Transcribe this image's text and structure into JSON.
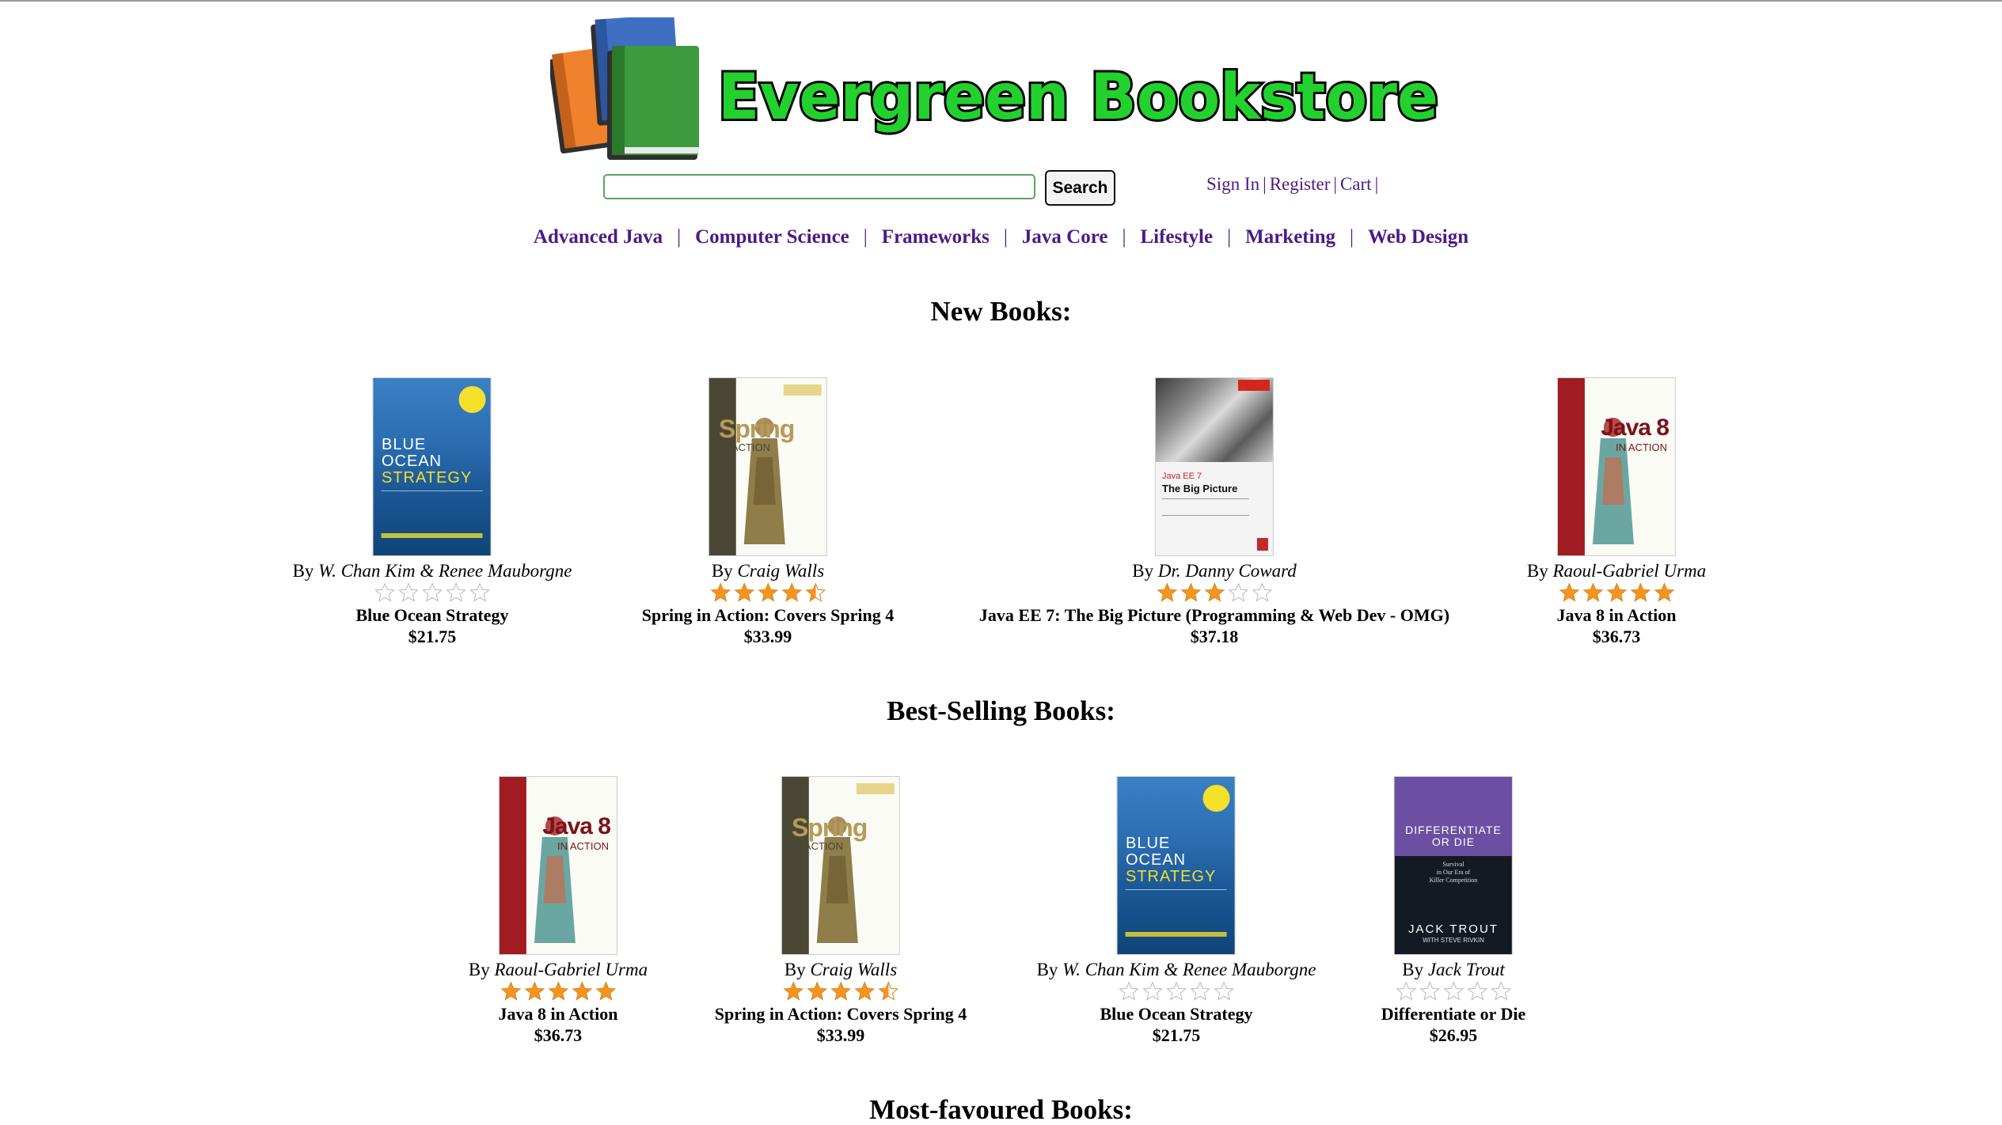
{
  "header": {
    "logo_text": "Evergreen Bookstore",
    "logo_colors": {
      "text_fill": "#22d12e",
      "text_outline": "#000000",
      "book_orange": "#f0822d",
      "book_blue": "#3f6fc2",
      "book_green": "#3c9b3c"
    }
  },
  "search": {
    "input_value": "",
    "button_label": "Search"
  },
  "account": {
    "sign_in": "Sign In",
    "register": "Register",
    "cart": "Cart",
    "separator": "|"
  },
  "categories": [
    "Advanced Java",
    "Computer Science",
    "Frameworks",
    "Java Core",
    "Lifestyle",
    "Marketing",
    "Web Design"
  ],
  "category_separator": "|",
  "sections": {
    "new_books": {
      "title": "New Books:",
      "books": [
        {
          "by": "By",
          "author": "W. Chan Kim & Renee Mauborgne",
          "rating": 0,
          "title": "Blue Ocean Strategy",
          "price": "$21.75",
          "cover": "blue-ocean"
        },
        {
          "by": "By",
          "author": "Craig Walls",
          "rating": 4.5,
          "title": "Spring in Action: Covers Spring 4",
          "price": "$33.99",
          "cover": "spring"
        },
        {
          "by": "By",
          "author": "Dr. Danny Coward",
          "rating": 3,
          "title": "Java EE 7: The Big Picture (Programming & Web Dev - OMG)",
          "price": "$37.18",
          "cover": "java-ee"
        },
        {
          "by": "By",
          "author": "Raoul-Gabriel Urma",
          "rating": 5,
          "title": "Java 8 in Action",
          "price": "$36.73",
          "cover": "java8"
        }
      ]
    },
    "best_selling": {
      "title": "Best-Selling Books:",
      "books": [
        {
          "by": "By",
          "author": "Raoul-Gabriel Urma",
          "rating": 5,
          "title": "Java 8 in Action",
          "price": "$36.73",
          "cover": "java8"
        },
        {
          "by": "By",
          "author": "Craig Walls",
          "rating": 4.5,
          "title": "Spring in Action: Covers Spring 4",
          "price": "$33.99",
          "cover": "spring"
        },
        {
          "by": "By",
          "author": "W. Chan Kim & Renee Mauborgne",
          "rating": 0,
          "title": "Blue Ocean Strategy",
          "price": "$21.75",
          "cover": "blue-ocean"
        },
        {
          "by": "By",
          "author": "Jack Trout",
          "rating": 0,
          "title": "Differentiate or Die",
          "price": "$26.95",
          "cover": "differentiate"
        }
      ]
    },
    "most_favoured": {
      "title": "Most-favoured Books:"
    }
  },
  "colors": {
    "link": "#4b1a86",
    "star_filled": "#f7941d",
    "star_empty": "#bdbdbd",
    "search_border": "#5aa65a"
  }
}
